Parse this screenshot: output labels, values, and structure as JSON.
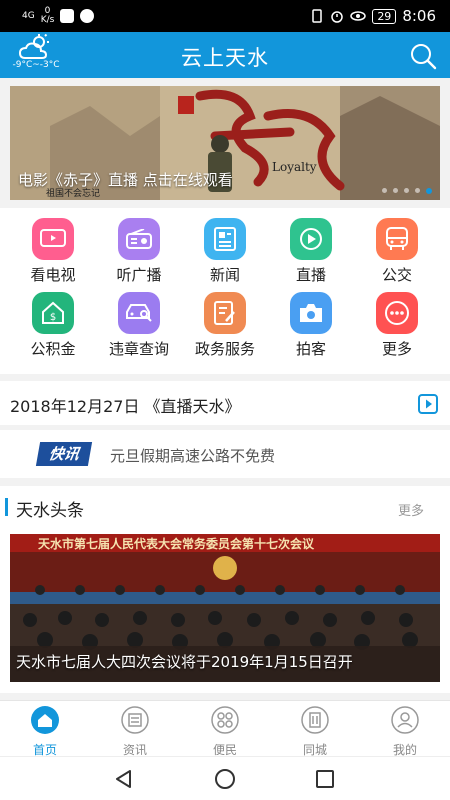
{
  "status_bar": {
    "network": "4G",
    "speed_value": "0",
    "speed_unit": "K/s",
    "battery": "29",
    "time": "8:06"
  },
  "header": {
    "title": "云上天水",
    "weather_temp": "-9°C~-3°C",
    "accent_color": "#1296db"
  },
  "banner": {
    "caption": "电影《赤子》直播  点击在线观看",
    "subtitle_text": "祖国不会忘记",
    "art_word": "Loyalty",
    "slide_count": 5,
    "active_slide": 5
  },
  "quick_grid": {
    "items": [
      {
        "label": "看电视",
        "icon": "tv-icon",
        "color": "#ff5e8f"
      },
      {
        "label": "听广播",
        "icon": "radio-icon",
        "color": "#a97ff0"
      },
      {
        "label": "新闻",
        "icon": "news-icon",
        "color": "#3fb4f0"
      },
      {
        "label": "直播",
        "icon": "live-icon",
        "color": "#2fc38f"
      },
      {
        "label": "公交",
        "icon": "bus-icon",
        "color": "#ff7a52"
      },
      {
        "label": "公积金",
        "icon": "housing-fund-icon",
        "color": "#23b57c"
      },
      {
        "label": "违章查询",
        "icon": "car-search-icon",
        "color": "#9b7cf0"
      },
      {
        "label": "政务服务",
        "icon": "gov-service-icon",
        "color": "#f08a52"
      },
      {
        "label": "拍客",
        "icon": "camera-icon",
        "color": "#4a9ff2"
      },
      {
        "label": "更多",
        "icon": "more-icon",
        "color": "#ff5252"
      }
    ]
  },
  "live_row": {
    "text": "2018年12月27日 《直播天水》"
  },
  "flash_news": {
    "logo": "快讯",
    "text": "元旦假期高速公路不免费"
  },
  "headlines": {
    "title": "天水头条",
    "more": "更多",
    "image_banner_text": "天水市第七届人民代表大会常务委员会第十七次会议",
    "caption": "天水市七届人大四次会议将于2019年1月15日召开"
  },
  "tabbar": {
    "items": [
      {
        "label": "首页",
        "icon": "home-icon",
        "active": true
      },
      {
        "label": "资讯",
        "icon": "info-icon",
        "active": false
      },
      {
        "label": "便民",
        "icon": "services-icon",
        "active": false
      },
      {
        "label": "同城",
        "icon": "city-icon",
        "active": false
      },
      {
        "label": "我的",
        "icon": "profile-icon",
        "active": false
      }
    ]
  }
}
